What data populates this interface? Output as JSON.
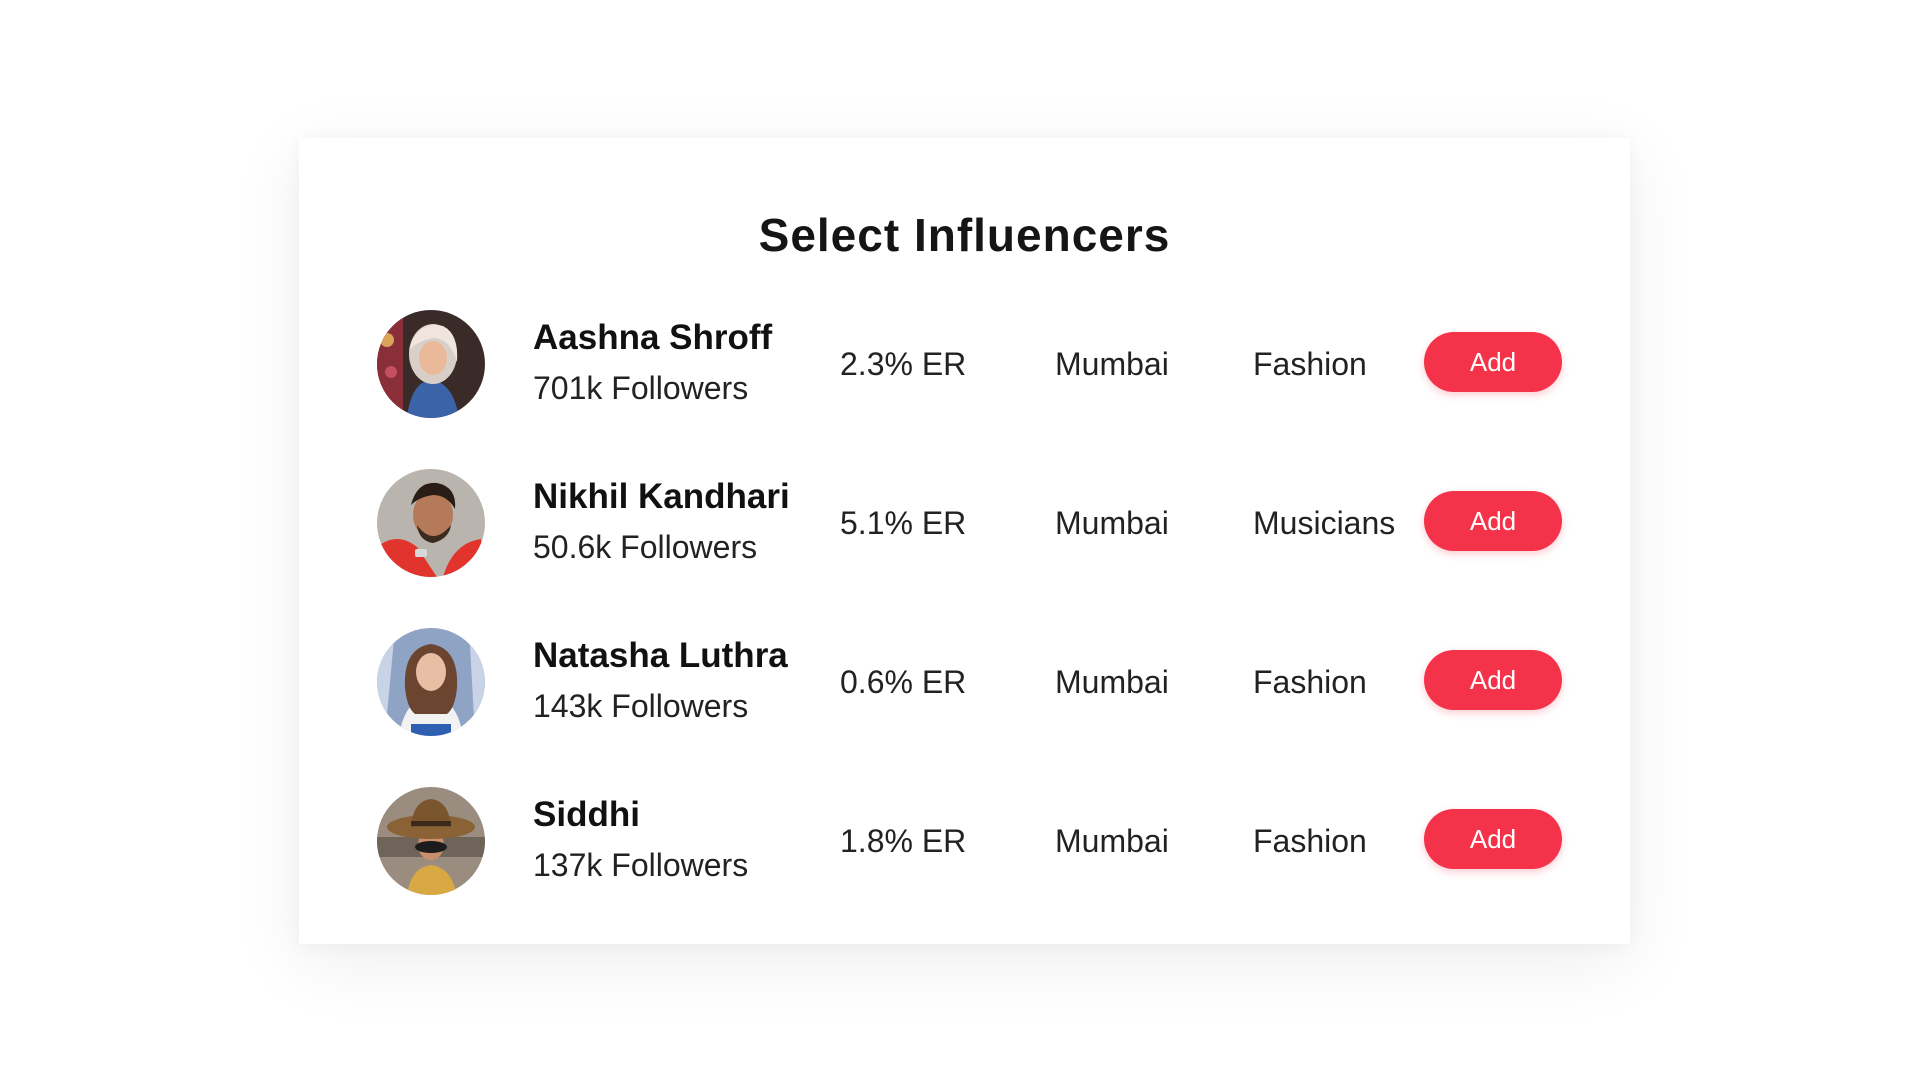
{
  "title": "Select Influencers",
  "accent_color": "#f4334a",
  "influencers": [
    {
      "name": "Aashna Shroff",
      "followers": "701k Followers",
      "engagement": "2.3% ER",
      "city": "Mumbai",
      "category": "Fashion",
      "action_label": "Add"
    },
    {
      "name": "Nikhil Kandhari",
      "followers": "50.6k Followers",
      "engagement": "5.1% ER",
      "city": "Mumbai",
      "category": "Musicians",
      "action_label": "Add"
    },
    {
      "name": "Natasha Luthra",
      "followers": "143k Followers",
      "engagement": "0.6% ER",
      "city": "Mumbai",
      "category": "Fashion",
      "action_label": "Add"
    },
    {
      "name": "Siddhi",
      "followers": "137k Followers",
      "engagement": "1.8% ER",
      "city": "Mumbai",
      "category": "Fashion",
      "action_label": "Add"
    }
  ]
}
